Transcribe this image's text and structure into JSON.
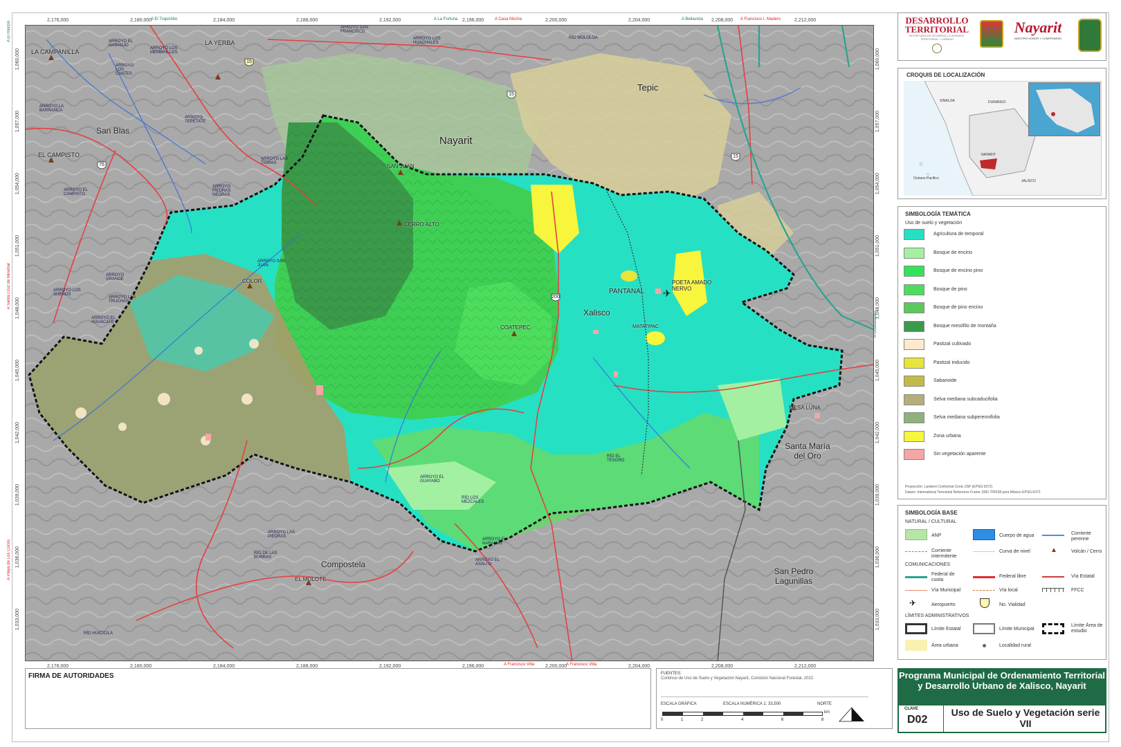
{
  "header": {
    "logo1_line1": "DESARROLLO",
    "logo1_line2": "TERRITORIAL",
    "logo1_sub": "SECRETARÍA DE DESARROLLO AGRARIO, TERRITORIAL Y URBANO",
    "logo3_brand": "Nayarit",
    "logo3_motto": "NUESTRO HONOR Y COMPROMISO"
  },
  "colors": {
    "accent_green": "#1e6b45",
    "logo_red": "#b8182f"
  },
  "map": {
    "x_ticks_top": [
      "2,176,000",
      "2,180,000",
      "2,184,000",
      "2,188,000",
      "2,192,000",
      "2,196,000",
      "2,200,000",
      "2,204,000",
      "2,208,000",
      "2,212,000"
    ],
    "x_ticks_bottom": [
      "2,178,000",
      "2,180,000",
      "2,184,000",
      "2,188,000",
      "2,192,000",
      "2,196,000",
      "2,200,000",
      "2,204,000",
      "2,208,000",
      "2,212,000"
    ],
    "y_ticks": [
      "1,060,000",
      "1,057,000",
      "1,054,000",
      "1,051,000",
      "1,048,000",
      "1,045,000",
      "1,042,000",
      "1,039,000",
      "1,036,000",
      "1,033,000"
    ],
    "destinations": {
      "el_trapichito": "A El Trapichito",
      "la_fortuna": "A La Fortuna",
      "casa_mocha": "A Casa Mocha",
      "bellavista": "A Bellavista",
      "francisco_i_madero": "A Francisco I. Madero",
      "el_rincon": "A El Rincón",
      "santa_cruz": "A Santa Cruz de Miramar",
      "guadalajara": "A Guadalajara",
      "francisco_villa_1": "A Francisco Villa",
      "francisco_villa_2": "A Francisco Villa",
      "playa_mazatlan": "A Playa de Los Cocos"
    },
    "places": {
      "la_campanilla": "LA CAMPANILLA",
      "la_yerba": "LA YERBA",
      "san_blas": "San Blas",
      "el_campisto": "EL CAMPISTO",
      "nayarit": "Nayarit",
      "tepic": "Tepic",
      "san_juan": "SAN JUAN",
      "cerro_alto": "CERRO ALTO",
      "color": "COLOR",
      "pantanal": "PANTANAL",
      "poeta_amado_nervo": "POETA AMADO NERVO",
      "xalisco": "Xalisco",
      "matatipac": "MATATIPAC",
      "coatepec": "COATEPEC",
      "mesa_luna": "MESA LUNA",
      "santa_maria_del_oro": "Santa María del Oro",
      "compostela": "Compostela",
      "el_molote": "EL MOLOTE",
      "san_pedro_lagunillas": "San Pedro Lagunillas"
    },
    "arroyos": [
      "ARROYO EL NARANJO",
      "ARROYO LOS MEMBRILLOS",
      "ARROYO LOS CUATES",
      "ARROYO LA BARRANCA",
      "ARROYO TEPETATE",
      "ARROYO EL CAMPISTO",
      "ARROYO LAS TIGRAS",
      "ARROYO PIEDRAS NEGRAS",
      "ARROYO SAN JUAN",
      "ARROYO GRANDE",
      "ARROYO LAS TRUCHAS",
      "ARROYO EL AGUACATE",
      "ARROYO LOS SUEÑOS",
      "ARROYO EL GUAYABO",
      "RÍO LOS MEZCALES",
      "ARROYO LAS PIEDRAS",
      "RÍO DE LAS BURRAS",
      "ARROYO EL ASALTO",
      "RÍO EL TESORO",
      "RÍO HUICICILA",
      "ARROYO EL NARANJO",
      "ARROYO SAN FRANCISCO",
      "ARROYO LOS HUACHALES",
      "RÍO MOLOLOA"
    ],
    "road_shields": [
      "15",
      "200",
      "15",
      "76",
      "15"
    ]
  },
  "localizacion": {
    "title": "CROQUIS DE LOCALIZACIÓN",
    "labels": {
      "sinaloa": "SINALOA",
      "durango": "DURANGO",
      "nayarit": "NAYARIT",
      "oceano": "Océano Pacífico",
      "jalisco": "JALISCO"
    }
  },
  "tematica": {
    "title": "SIMBOLOGÍA TEMÁTICA",
    "subtitle": "Uso de suelo y vegetación",
    "items": [
      {
        "label": "Agricultura de temporal",
        "color": "#26e0c4"
      },
      {
        "label": "Bosque de encino",
        "color": "#a3f0a3"
      },
      {
        "label": "Bosque de encino pino",
        "color": "#35e35a"
      },
      {
        "label": "Bosque de pino",
        "color": "#4ddd5d"
      },
      {
        "label": "Bosque de pino encino",
        "color": "#5cc75c"
      },
      {
        "label": "Bosque mesófilo de montaña",
        "color": "#3a9a4a"
      },
      {
        "label": "Pastizal cultivado",
        "color": "#fbeacc"
      },
      {
        "label": "Pastizal inducido",
        "color": "#e8e43a"
      },
      {
        "label": "Sabanoide",
        "color": "#c2bb4a"
      },
      {
        "label": "Selva mediana subcaducifolia",
        "color": "#b5ae7a"
      },
      {
        "label": "Selva mediana subperennifolia",
        "color": "#8fb27a"
      },
      {
        "label": "Zona urbana",
        "color": "#f7f53c"
      },
      {
        "label": "Sin vegetación aparente",
        "color": "#f6a5a5"
      }
    ],
    "proyeccion": "Proyección: Lambert Conformal Conic 2SP (EPSG:6372)",
    "datum": "Datum: International Terrestrial Reference Frame 1992 ITRF08 para México EPSG:6372"
  },
  "base": {
    "title": "SIMBOLOGÍA BASE",
    "natural_title": "NATURAL / CULTURAL",
    "anp": "ANP",
    "cuerpo_agua": "Cuerpo de agua",
    "corriente_perenne": "Corriente perenne",
    "corriente_intermitente": "Corriente intermitente",
    "curva_nivel": "Curva de nivel",
    "volcan": "Volcán / Cerro",
    "comunicaciones_title": "COMUNICACIONES",
    "federal_cuota": "Federal de cuota",
    "federal_libre": "Federal libre",
    "via_estatal": "Vía Estatal",
    "via_municipal": "Vía Municipal",
    "via_local": "Vía local",
    "ffcc": "FFCC",
    "aeropuerto": "Aeropuerto",
    "no_vialidad": "No. Vialidad",
    "limites_title": "LÍMITES ADMINISTRATIVOS",
    "limite_estatal": "Límite Estatal",
    "limite_municipal": "Límite Municipal",
    "limite_area": "Límite Área de estudio",
    "area_urbana": "Área urbana",
    "localidad_rural": "Localidad rural"
  },
  "footer": {
    "firma": "FIRMA DE AUTORIDADES",
    "fuentes_title": "FUENTES:",
    "fuentes_text": "Continuo de Uso de Suelo y Vegetación Nayarit, Comisión Nacional Forestal, 2022.",
    "escala_grafica": "ESCALA GRÁFICA",
    "escala_numerica": "ESCALA NUMÉRICA 1: 33,500",
    "norte": "NORTE",
    "km": "km",
    "scale_ticks": [
      "0",
      "1",
      "2",
      "4",
      "6",
      "8"
    ]
  },
  "title_block": {
    "program": "Programa Municipal de Ordenamiento Territorial y Desarrollo Urbano de Xalisco, Nayarit",
    "clave_label": "CLAVE",
    "clave": "D02",
    "map_title": "Uso de Suelo y Vegetación serie VII"
  }
}
